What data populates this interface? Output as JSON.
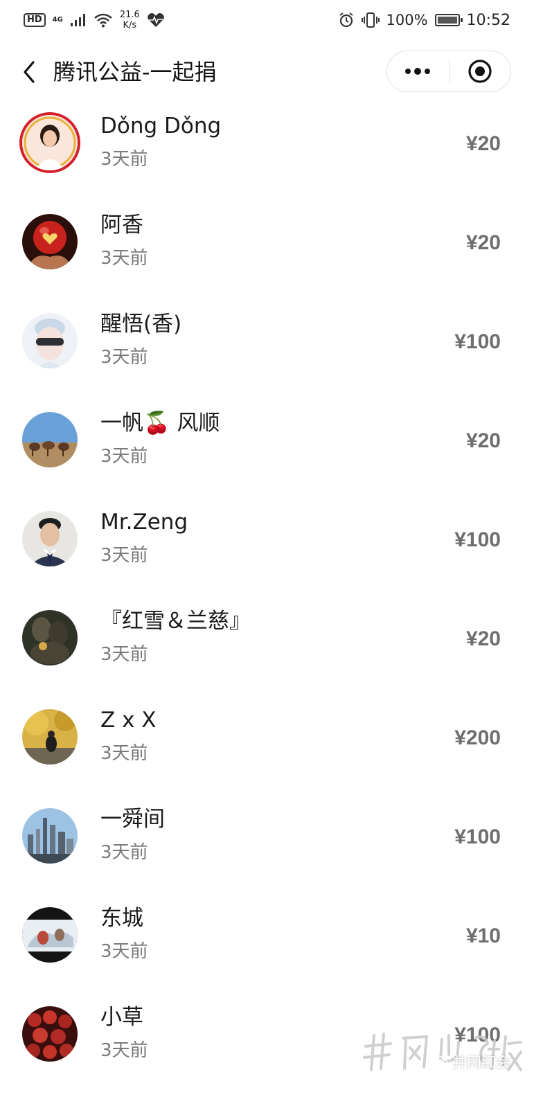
{
  "status_bar": {
    "hd": "HD",
    "network": "4G",
    "speed_value": "21.6",
    "speed_unit": "K/s",
    "battery": "100%",
    "time": "10:52"
  },
  "nav": {
    "title": "腾讯公益-一起捐"
  },
  "donors": [
    {
      "name": "Dǒng Dǒng",
      "time": "3天前",
      "amount": "¥20"
    },
    {
      "name": "阿香",
      "time": "3天前",
      "amount": "¥20"
    },
    {
      "name": "醒悟(香)",
      "time": "3天前",
      "amount": "¥100"
    },
    {
      "name": "一帆🍒 风顺",
      "time": "3天前",
      "amount": "¥20"
    },
    {
      "name": "Mr.Zeng",
      "time": "3天前",
      "amount": "¥100"
    },
    {
      "name": "『红雪＆兰慈』",
      "time": "3天前",
      "amount": "¥20"
    },
    {
      "name": "Z x X",
      "time": "3天前",
      "amount": "¥200"
    },
    {
      "name": "一舜间",
      "time": "3天前",
      "amount": "¥100"
    },
    {
      "name": "东城",
      "time": "3天前",
      "amount": "¥10"
    },
    {
      "name": "小草",
      "time": "3天前",
      "amount": "¥100"
    }
  ],
  "watermark": {
    "account": "井冈红会"
  }
}
